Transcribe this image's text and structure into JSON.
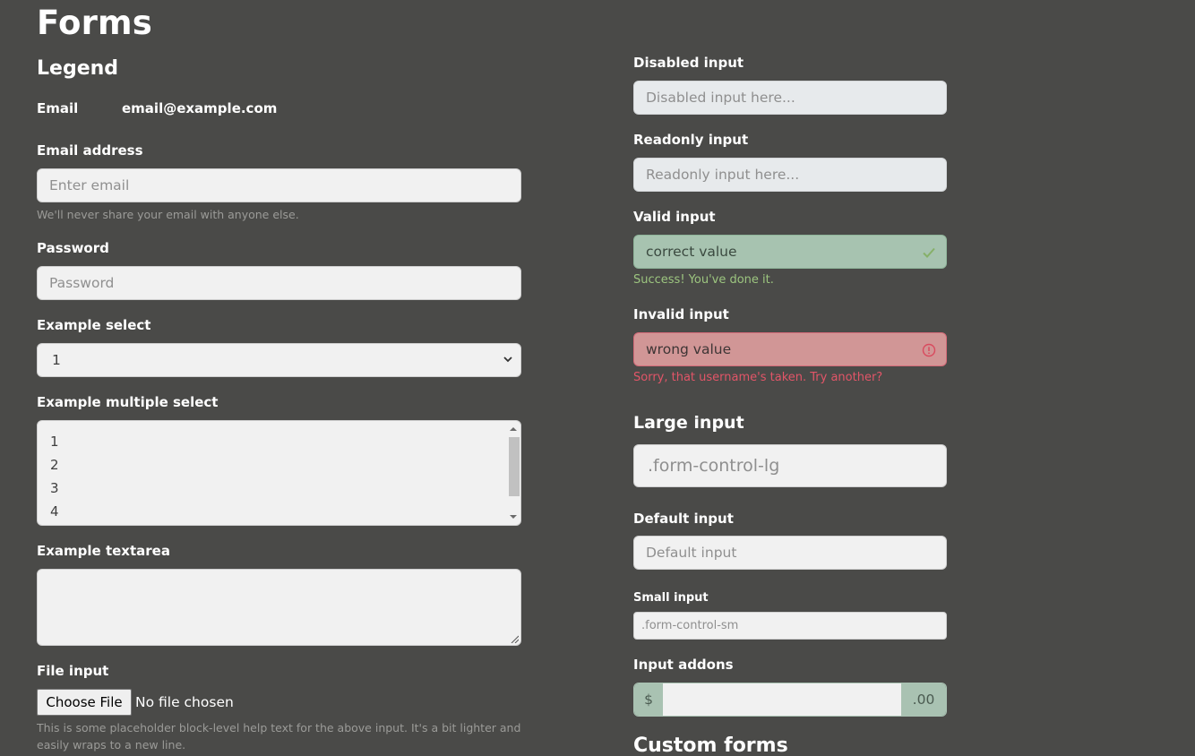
{
  "page": {
    "title": "Forms",
    "legend": "Legend"
  },
  "left": {
    "email_static_label": "Email",
    "email_static_value": "email@example.com",
    "email_label": "Email address",
    "email_placeholder": "Enter email",
    "email_help": "We'll never share your email with anyone else.",
    "password_label": "Password",
    "password_placeholder": "Password",
    "select_label": "Example select",
    "select_value": "1",
    "multi_label": "Example multiple select",
    "multi_options": [
      "1",
      "2",
      "3",
      "4"
    ],
    "textarea_label": "Example textarea",
    "file_label": "File input",
    "file_button": "Choose File",
    "file_status": "No file chosen",
    "file_help": "This is some placeholder block-level help text for the above input. It's a bit lighter and easily wraps to a new line."
  },
  "right": {
    "disabled_label": "Disabled input",
    "disabled_placeholder": "Disabled input here...",
    "readonly_label": "Readonly input",
    "readonly_placeholder": "Readonly input here...",
    "valid_label": "Valid input",
    "valid_value": "correct value",
    "valid_feedback": "Success! You've done it.",
    "invalid_label": "Invalid input",
    "invalid_value": "wrong value",
    "invalid_feedback": "Sorry, that username's taken. Try another?",
    "large_heading": "Large input",
    "large_placeholder": ".form-control-lg",
    "default_label": "Default input",
    "default_placeholder": "Default input",
    "small_label": "Small input",
    "small_placeholder": ".form-control-sm",
    "addons_label": "Input addons",
    "addon_prefix": "$",
    "addon_suffix": ".00",
    "custom_heading": "Custom forms"
  },
  "colors": {
    "background": "#4a4a48",
    "valid": "#9cc57f",
    "invalid": "#e25568"
  }
}
